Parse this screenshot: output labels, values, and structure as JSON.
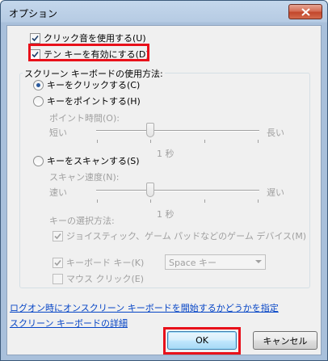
{
  "window": {
    "title": "オプション"
  },
  "options": {
    "click_sound": "クリック音を使用する(U)",
    "numpad": "テン キーを有効にする(D)"
  },
  "group": {
    "label": "スクリーン キーボードの使用方法:",
    "radio_click": "キーをクリックする(C)",
    "radio_hover": "キーをポイントする(H)",
    "hover_time_label": "ポイント時間(O):",
    "hover_short": "短い",
    "hover_long": "長い",
    "hover_value": "1 秒",
    "radio_scan": "キーをスキャンする(S)",
    "scan_speed_label": "スキャン速度(N):",
    "scan_fast": "速い",
    "scan_slow": "遅い",
    "scan_value": "1 秒",
    "key_select_label": "キーの選択方法:",
    "joystick": "ジョイスティック、ゲーム パッドなどのゲーム デバイス(M)",
    "keyboard_key": "キーボード キー(K)",
    "keyboard_key_value": "Space キー",
    "mouse_click": "マウス クリック(E)"
  },
  "links": {
    "logon": "ログオン時にオンスクリーン キーボードを開始するかどうかを指定",
    "details": "スクリーン キーボードの詳細"
  },
  "buttons": {
    "ok": "OK",
    "cancel": "キャンセル"
  },
  "state": {
    "click_sound_checked": true,
    "numpad_checked": true,
    "mode": "click",
    "joystick_checked": true,
    "keyboard_key_checked": true,
    "mouse_click_checked": false
  },
  "colors": {
    "highlight": "#e8101a",
    "link": "#0645c6"
  }
}
